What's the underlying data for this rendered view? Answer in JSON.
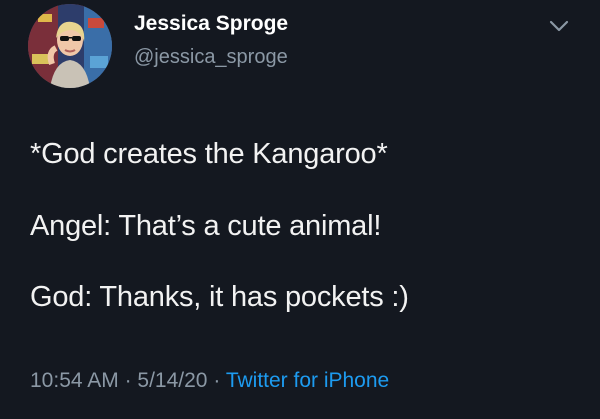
{
  "tweet": {
    "author_name": "Jessica Sproge",
    "author_handle": "@jessica_sproge",
    "lines": [
      "*God creates the Kangaroo*",
      "Angel: That’s a cute animal!",
      "God: Thanks, it has pockets :)"
    ],
    "time": "10:54 AM",
    "date": "5/14/20",
    "separator": "·",
    "source": "Twitter for iPhone"
  },
  "icons": {
    "menu": "chevron-down-icon",
    "avatar": "profile-avatar"
  },
  "colors": {
    "background": "#141820",
    "primary_text": "#ffffff",
    "secondary_text": "#8b98a5",
    "link": "#1d9bf0"
  }
}
